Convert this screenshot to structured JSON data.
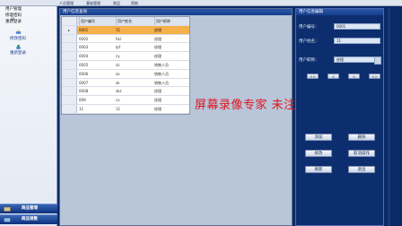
{
  "menubar": {
    "items": [
      "人员管理",
      "基础管理",
      "商品",
      "帮助"
    ]
  },
  "left_menu": {
    "dropdown_items": [
      "用户管理",
      "修改密码",
      "重新登录"
    ],
    "shortcuts": [
      {
        "label": "修改密码",
        "icon": "pencil-icon"
      },
      {
        "label": "重新登录",
        "icon": "login-icon"
      }
    ],
    "nav_buttons": [
      "商品管理",
      "商品销售"
    ]
  },
  "grid_panel": {
    "title": "用户信息查询",
    "columns": [
      "用户编号",
      "用户姓名",
      "用户职称"
    ],
    "row_marker": "▸",
    "rows": [
      [
        "0001",
        "11",
        "经理"
      ],
      [
        "0002",
        "hkl",
        "经理"
      ],
      [
        "0003",
        "lpf",
        "经理"
      ],
      [
        "0004",
        "cy",
        "经理"
      ],
      [
        "0005",
        "zz",
        "销售人员"
      ],
      [
        "0006",
        "zx",
        "销售人员"
      ],
      [
        "0007",
        "zk",
        "销售人员"
      ],
      [
        "0008",
        "zkz",
        "经理"
      ],
      [
        "009",
        "cv",
        "经理"
      ],
      [
        "11",
        "11",
        "经理"
      ]
    ],
    "selected_row": 0
  },
  "watermark": "屏幕录像专家  未注册",
  "form_panel": {
    "title": "用户信息编辑",
    "user_id_label": "用户编号：",
    "user_id_value": "0001",
    "user_name_label": "用户姓名：",
    "user_name_value": "11",
    "user_role_label": "用户职称：",
    "user_role_value": "经理",
    "nav": [
      "<<",
      "<",
      ">",
      ">>"
    ],
    "buttons": {
      "add": "添加",
      "delete": "删除",
      "modify": "修改",
      "cancel": "取消操作",
      "refresh": "刷新",
      "exit": "退出"
    }
  },
  "colors": {
    "background": "#0a2a66",
    "selected_row": "#f6b04a",
    "watermark": "#e0141e"
  }
}
